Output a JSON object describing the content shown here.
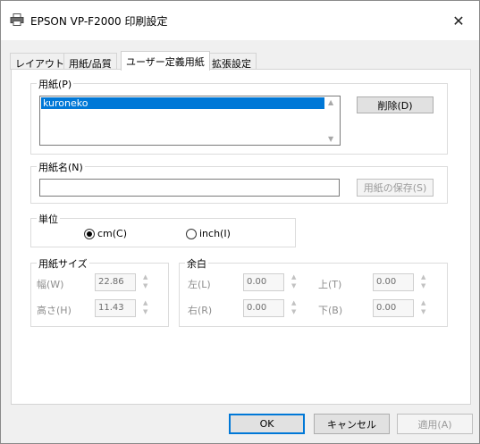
{
  "window": {
    "title": "EPSON VP-F2000 印刷設定",
    "close_glyph": "✕"
  },
  "tabs": [
    {
      "label": "レイアウト"
    },
    {
      "label": "用紙/品質"
    },
    {
      "label": "ユーザー定義用紙",
      "active": true
    },
    {
      "label": "拡張設定"
    }
  ],
  "paper_group": {
    "label": "用紙(P)",
    "items": [
      "kuroneko"
    ],
    "selected": "kuroneko",
    "delete_label": "削除(D)"
  },
  "paper_name_group": {
    "label": "用紙名(N)",
    "value": "",
    "save_label": "用紙の保存(S)"
  },
  "unit_group": {
    "label": "単位",
    "options": [
      {
        "label": "cm(C)",
        "selected": true
      },
      {
        "label": "inch(I)",
        "selected": false
      }
    ]
  },
  "size_group": {
    "label": "用紙サイズ",
    "width_label": "幅(W)",
    "width_value": "22.86",
    "height_label": "高さ(H)",
    "height_value": "11.43"
  },
  "margin_group": {
    "label": "余白",
    "left_label": "左(L)",
    "left_value": "0.00",
    "top_label": "上(T)",
    "top_value": "0.00",
    "right_label": "右(R)",
    "right_value": "0.00",
    "bottom_label": "下(B)",
    "bottom_value": "0.00"
  },
  "footer": {
    "ok_label": "OK",
    "cancel_label": "キャンセル",
    "apply_label": "適用(A)"
  },
  "colors": {
    "selection": "#0078d7",
    "default_button_border": "#0078d7"
  }
}
